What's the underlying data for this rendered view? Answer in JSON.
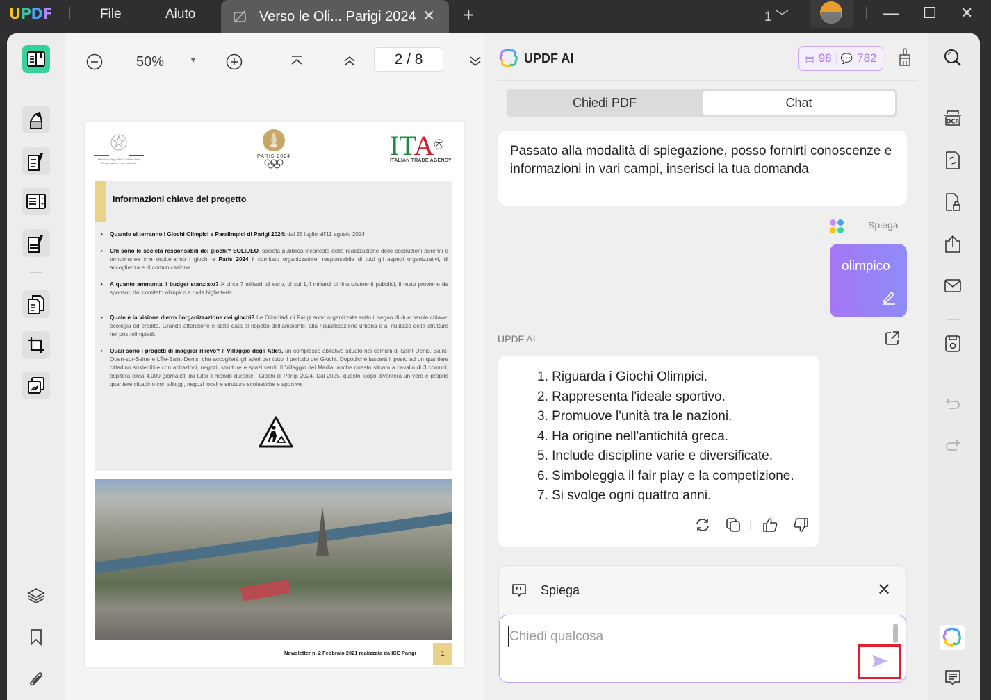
{
  "titlebar": {
    "logo": {
      "u": "U",
      "p": "P",
      "d": "D",
      "f": "F"
    },
    "menu": [
      "File",
      "Aiuto"
    ],
    "tab": {
      "title": "Verso le Oli... Parigi 2024",
      "icon": "document-broken-icon",
      "close": "✕"
    },
    "new_tab": "+",
    "window_count": "1",
    "window_controls": {
      "minimize": "—",
      "maximize": "☐",
      "close": "✕"
    }
  },
  "left_sidebar": {
    "tools": [
      "reader",
      "comment",
      "edit-pdf",
      "fill-sign",
      "redact",
      "organize-pages",
      "crop",
      "convert"
    ],
    "bottom": [
      "layers",
      "bookmark",
      "attachment"
    ]
  },
  "viewer_toolbar": {
    "zoom_out": "⊖",
    "zoom_level": "50%",
    "zoom_dropdown": "▼",
    "zoom_in": "⊕",
    "current_page": "2",
    "total_pages": "8",
    "page_display": "2  /  8"
  },
  "pdf_page": {
    "header_logos": {
      "ministry": "Ministero degli Affari Esteri e della Cooperazione Internazionale",
      "paris": "PARIS 2024",
      "ita_main": "ITA",
      "ita_sub": "ITALIAN TRADE AGENCY"
    },
    "box_title": "Informazioni chiave del progetto",
    "bullets": [
      {
        "q": "Quando si terranno i Giochi Olimpici e Paralimpici di Parigi 2024:",
        "a": " dal 26 luglio all’11 agosto 2024"
      },
      {
        "q": "Chi sono le società responsabili dei giochi? SOLIDEO",
        "a": ", società pubblica incaricata della realizzazione delle costruzioni perenni e temporanee che ospiteranno i giochi e ",
        "q2": "Paris 2024",
        "a2": " il comitato organizzatore, responsabile di tutti gli aspetti organizzativi, di accoglienza e di comunicazione."
      },
      {
        "q": "A quanto ammonta il budget stanziato?",
        "a": " A circa 7 miliardi di euro, di cui 1,4 miliardi di finanziamenti pubblici, il resto proviene da sponsor, dal comitato olimpico e dalla biglietteria."
      },
      {
        "q": "Quale è la visione dietro l’organizzazione dei giochi?",
        "a": " Le Olimpiadi di Parigi sono organizzate sotto il segno di due parole chiave: ecologia ed eredità. Grande attenzione è stata data al rispetto dell’ambiente, alla riqualificazione urbana e al riutilizzo della strutture nel post-olimpiadi."
      },
      {
        "q": "Quali sono i progetti di maggior rilievo? Il Villaggio degli Atleti,",
        "a": " un complesso abitativo situato nei comuni di Saint-Denis, Saint-Ouen-sur-Seine e L’Île-Saint-Denis, che accoglierà gli atleti per tutto il periodo dei Giochi. Dopodiché lascerà il posto ad un quartiere cittadino sostenibile con abitazioni, negozi, strutture e spazi verdi. Il Villaggio dei Media, anche questo situato a cavallo di 3 comuni, ospiterà circa 4.000 giornalisti da tutto il mondo durante i Giochi di Parigi 2024. Dal 2025, questo luogo diventerà un vero e proprio quartiere cittadino con alloggi, negozi locali e strutture scolastiche e sportive."
      }
    ],
    "footer": "Newsletter n. 2 Febbraio 2021 realizzata da ICE Parigi",
    "page_number": "1"
  },
  "ai_panel": {
    "title": "UPDF AI",
    "credits": {
      "docs": "98",
      "chats": "782"
    },
    "tabs": [
      {
        "label": "Chiedi PDF",
        "active": false
      },
      {
        "label": "Chat",
        "active": true
      }
    ],
    "system_message": "Passato alla modalità di spiegazione, posso fornirti conoscenze e informazioni in vari campi, inserisci la tua domanda",
    "user_mode_label": "Spiega",
    "user_message": "olimpico",
    "ai_label": "UPDF AI",
    "ai_response": [
      "1. Riguarda i Giochi Olimpici.",
      "2. Rappresenta l'ideale sportivo.",
      "3. Promuove l'unità tra le nazioni.",
      "4. Ha origine nell'antichità greca.",
      "5. Include discipline varie e diversificate.",
      "6. Simboleggia il fair play e la competizione.",
      "7. Si svolge ogni quattro anni."
    ],
    "input_mode": "Spiega",
    "input_placeholder": "Chiedi qualcosa",
    "input_value": ""
  },
  "right_sidebar": {
    "tools": [
      "search",
      "ocr",
      "convert-file",
      "protect",
      "share",
      "email",
      "save",
      "undo",
      "redo",
      "updf-ai",
      "comments"
    ]
  },
  "colors": {
    "accent": "#a77cf5",
    "reader_active": "#33d39b",
    "highlight_red": "#e0202e"
  }
}
